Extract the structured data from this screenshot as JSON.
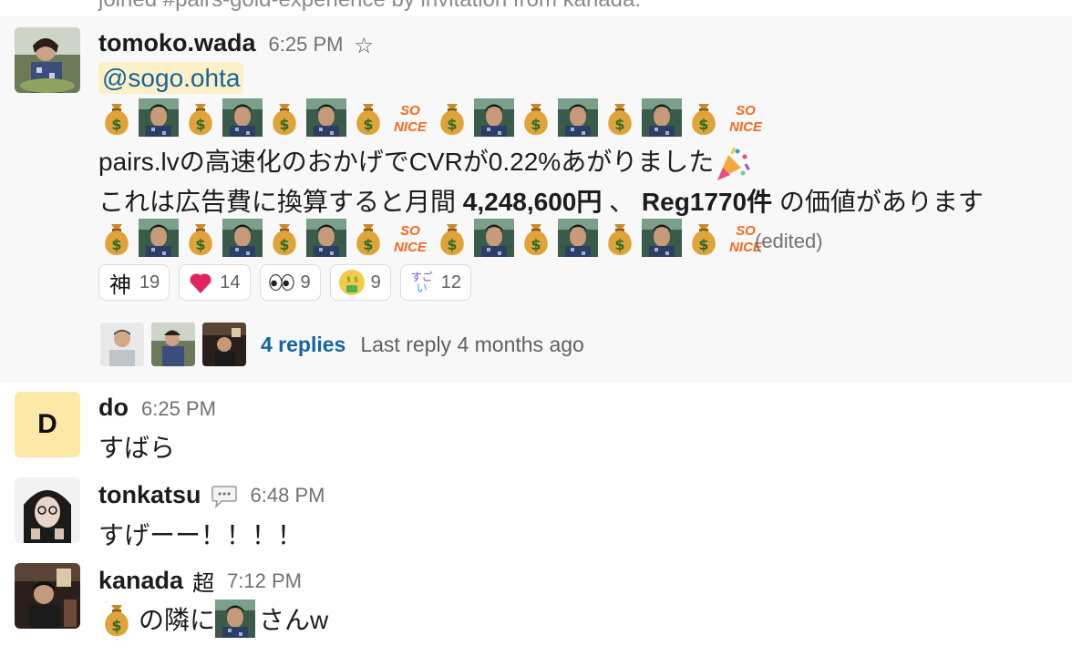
{
  "system_line": {
    "text": "joined #pairs-gold-experience by invitation from kanada."
  },
  "messages": [
    {
      "user": "tomoko.wada",
      "time": "6:25 PM",
      "mention": "@sogo.ohta",
      "emoji_strip_1": [
        "money-bag",
        "face",
        "money-bag",
        "face",
        "money-bag",
        "face",
        "money-bag",
        "so-nice",
        "money-bag",
        "face",
        "money-bag",
        "face",
        "money-bag",
        "face",
        "money-bag",
        "so-nice"
      ],
      "line1": "pairs.lvの高速化のおかげでCVRが0.22%あがりました",
      "line2_prefix": "これは広告費に換算すると月間 ",
      "line2_amount": "4,248,600円",
      "line2_mid": " 、 ",
      "line2_reg": "Reg1770件",
      "line2_suffix": " の価値があります",
      "edited_label": "(edited)",
      "reactions": [
        {
          "icon": "kami-kanji-icon",
          "glyph": "神",
          "count": "19"
        },
        {
          "icon": "heart-icon",
          "glyph": "❤",
          "count": "14"
        },
        {
          "icon": "eyes-icon",
          "glyph": "👀",
          "count": "9"
        },
        {
          "icon": "money-mouth-face-icon",
          "glyph": "🤑",
          "count": "9"
        },
        {
          "icon": "sugoi-icon",
          "glyph": "すご い",
          "count": "12"
        }
      ],
      "replies_label": "4 replies",
      "last_reply": "Last reply 4 months ago"
    },
    {
      "user": "do",
      "time": "6:25 PM",
      "text": "すばら",
      "avatar_letter": "D"
    },
    {
      "user": "tonkatsu",
      "status_icon": "speech-bubble-icon",
      "time": "6:48 PM",
      "text": "すげーー！！！！"
    },
    {
      "user": "kanada",
      "status_glyph": "超",
      "time": "7:12 PM",
      "text_mid": " の隣に ",
      "text_end": " さんw"
    }
  ],
  "colors": {
    "link": "#1264a3",
    "mention_bg": "#fdf0c6",
    "highlight_bg": "#f8f8f8",
    "so_nice": "#f26b21"
  }
}
